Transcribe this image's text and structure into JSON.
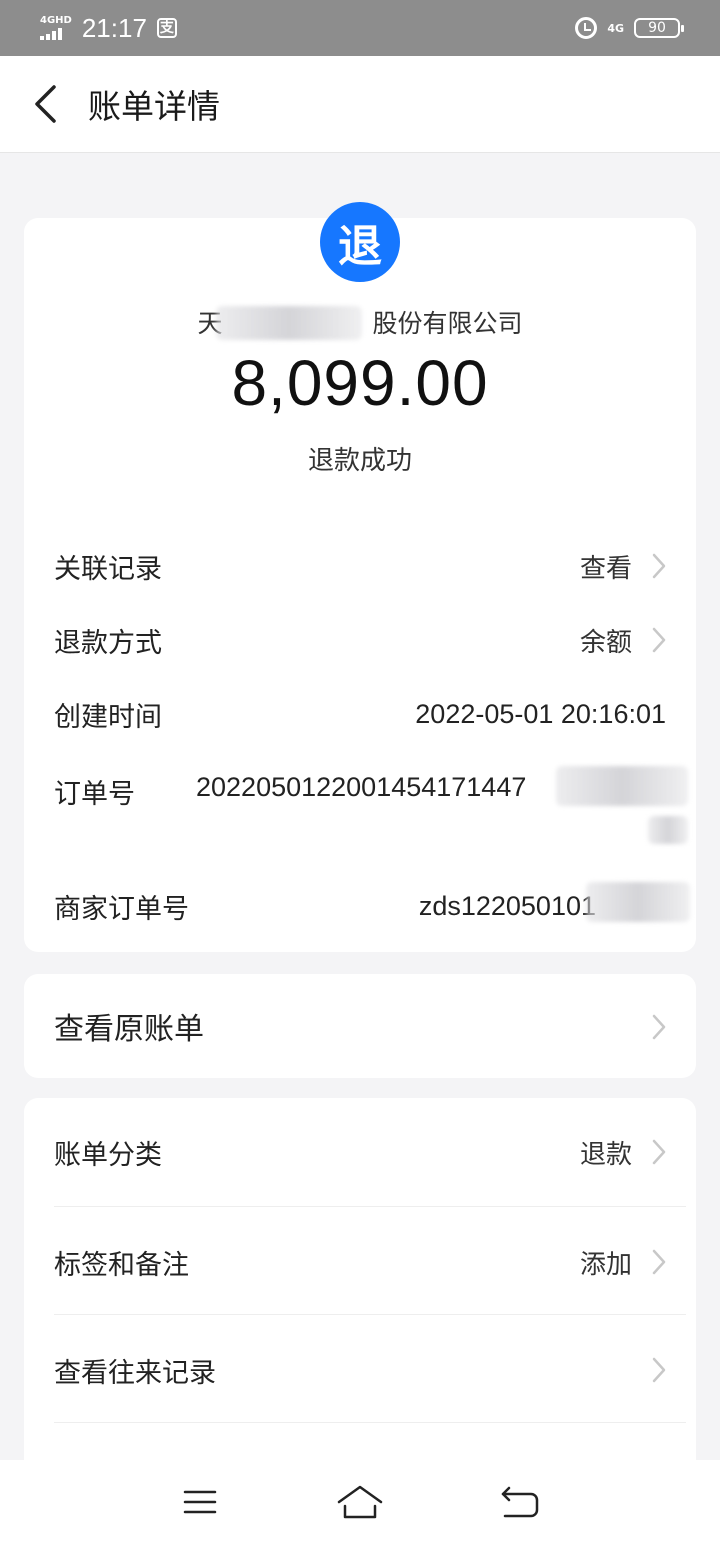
{
  "status_bar": {
    "signal_type": "4GHD",
    "time": "21:17",
    "alipay_badge": "支",
    "net_type": "4G",
    "battery": "90"
  },
  "header": {
    "title": "账单详情",
    "back_icon": "chevron-left-icon"
  },
  "summary": {
    "icon_text": "退",
    "icon_color": "#1677ff",
    "merchant_prefix": "天",
    "merchant_suffix": "股份有限公司",
    "amount": "8,099.00",
    "status": "退款成功"
  },
  "details": [
    {
      "label": "关联记录",
      "value": "查看",
      "chevron": true
    },
    {
      "label": "退款方式",
      "value": "余额",
      "chevron": true
    },
    {
      "label": "创建时间",
      "value": "2022-05-01 20:16:01",
      "chevron": false
    }
  ],
  "order": {
    "label": "订单号",
    "value": "2022050122001454171447"
  },
  "merchant_order": {
    "label": "商家订单号",
    "value": "zds122050101"
  },
  "original_bill": {
    "label": "查看原账单"
  },
  "more": [
    {
      "label": "账单分类",
      "value": "退款"
    },
    {
      "label": "标签和备注",
      "value": "添加"
    },
    {
      "label": "查看往来记录",
      "value": ""
    }
  ],
  "nav_bar": {
    "menu_icon": "menu-icon",
    "home_icon": "home-icon",
    "back_icon": "back-icon"
  }
}
